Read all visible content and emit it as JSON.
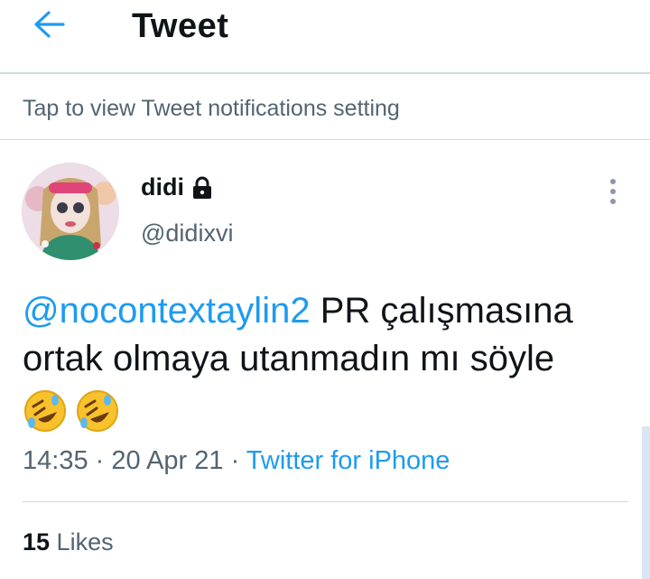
{
  "header": {
    "title": "Tweet",
    "back_icon": "arrow-left-icon"
  },
  "notification_bar": {
    "text": "Tap to view Tweet notifications setting"
  },
  "tweet": {
    "author": {
      "name": "didi",
      "handle": "@didixvi",
      "protected_icon": "lock-icon"
    },
    "mention": "@nocontextaylin2",
    "body": " PR çalışmasına ortak olmaya utanmadın mı söyle",
    "emojis": [
      "🤣",
      "🤣"
    ],
    "time": "14:35",
    "sep": " · ",
    "date": "20 Apr 21",
    "source": "Twitter for iPhone",
    "likes_count": "15",
    "likes_label": " Likes"
  },
  "colors": {
    "accent": "#1d9bf0",
    "muted": "#536471"
  }
}
